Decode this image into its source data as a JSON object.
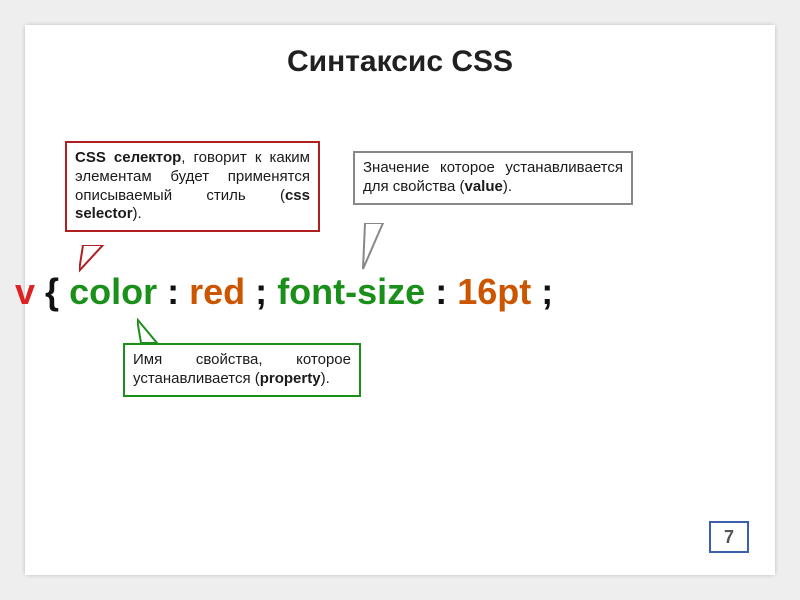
{
  "title": "Синтаксис CSS",
  "callouts": {
    "selector": {
      "text1": "CSS селектор",
      "text2": ", говорит к каким элементам будет применятся описываемый стиль (",
      "text3": "css selector",
      "text4": ")."
    },
    "value": {
      "text1": "Значение которое устанавливается для свойства (",
      "text2": "value",
      "text3": ")."
    },
    "property": {
      "text1": "Имя свойства, которое устанавливается (",
      "text2": "property",
      "text3": ")."
    }
  },
  "code": {
    "selector_frag": "v",
    "space": " ",
    "brace_open": "{",
    "prop1": "color",
    "colon": ":",
    "val1": "red",
    "semi": ";",
    "prop2": "font-size",
    "val2": "16pt"
  },
  "page_number": "7"
}
